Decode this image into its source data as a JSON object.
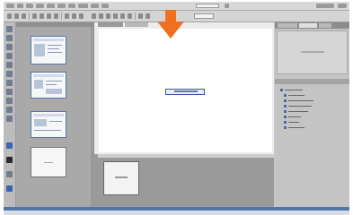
{
  "app": {
    "title": ""
  },
  "menubar": {
    "items": [
      "",
      "",
      "",
      "",
      "",
      "",
      "",
      "",
      "",
      ""
    ]
  },
  "toolbar": {
    "buttons": 22
  },
  "pages_panel": {
    "thumbnails": [
      {
        "label": ""
      },
      {
        "label": ""
      },
      {
        "label": ""
      },
      {
        "label": ""
      }
    ]
  },
  "canvas": {
    "widget_label": ""
  },
  "right_panel": {
    "tabs": [
      "",
      "",
      ""
    ],
    "layers": [
      "",
      "",
      "",
      "",
      "",
      "",
      "",
      ""
    ]
  },
  "colors": {
    "accent_arrow": "#f07020",
    "selection": "#3355aa",
    "statusbar": "#4f78a8"
  },
  "icons": [
    "pointer-arrow-icon"
  ]
}
